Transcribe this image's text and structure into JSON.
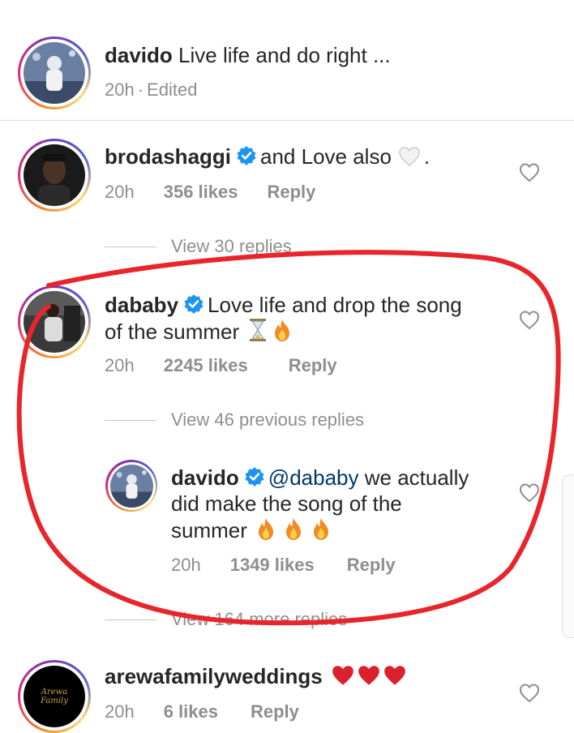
{
  "caption": {
    "username": "davido",
    "text": "Live life and do right ...",
    "time": "20h",
    "edited": "Edited",
    "separator": "·"
  },
  "comments": [
    {
      "username": "brodashaggi",
      "verified": true,
      "text": "and Love also",
      "emoji": [
        "white-heart"
      ],
      "trailing": ".",
      "time": "20h",
      "likes": "356 likes",
      "reply_label": "Reply",
      "view_replies": "View 30 replies"
    },
    {
      "username": "dababy",
      "verified": true,
      "text_line1": "Love life and drop the song",
      "text_line2": "of the summer",
      "emoji": [
        "hourglass",
        "fire"
      ],
      "time": "20h",
      "likes": "2245 likes",
      "reply_label": "Reply",
      "view_previous": "View 46 previous replies",
      "reply": {
        "username": "davido",
        "verified": true,
        "mention": "@dababy",
        "text_line1": "we actually",
        "text_line2": "did make the song of the",
        "text_line3": "summer",
        "emoji": [
          "fire",
          "fire",
          "fire"
        ],
        "time": "20h",
        "likes": "1349 likes",
        "reply_label": "Reply"
      },
      "view_more": "View 164 more replies"
    },
    {
      "username": "arewafamilyweddings",
      "verified": false,
      "emoji": [
        "red-heart",
        "red-heart",
        "red-heart"
      ],
      "time": "20h",
      "likes": "6 likes",
      "reply_label": "Reply",
      "avatar_text": "Arewa Family"
    }
  ],
  "colors": {
    "annotation": "#e8252b",
    "verified": "#1d95f0",
    "muted": "#8e8e8e",
    "mention": "#00376b"
  }
}
